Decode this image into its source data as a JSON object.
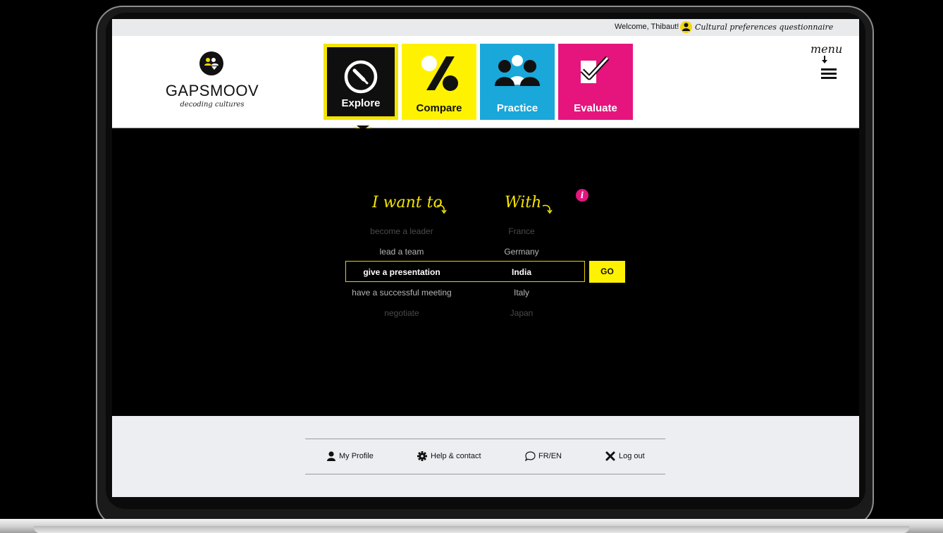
{
  "topbar": {
    "welcome": "Welcome, Thibaut!",
    "questionnaire": "Cultural preferences questionnaire"
  },
  "brand": {
    "name": "GAPSMOOV",
    "tagline": "decoding cultures"
  },
  "nav": {
    "tabs": [
      {
        "label": "Explore",
        "icon": "compass-icon",
        "color": "#0f0f0f",
        "active": true
      },
      {
        "label": "Compare",
        "icon": "percent-icon",
        "color": "#fff200",
        "active": false
      },
      {
        "label": "Practice",
        "icon": "group-icon",
        "color": "#1aa7d9",
        "active": false
      },
      {
        "label": "Evaluate",
        "icon": "checkmark-icon",
        "color": "#e5157d",
        "active": false
      }
    ],
    "menu_label": "menu"
  },
  "explore": {
    "want_heading": "I want to",
    "with_heading": "With",
    "want_options": [
      "become a leader",
      "lead a team",
      "give a presentation",
      "have a successful meeting",
      "negotiate"
    ],
    "with_options": [
      "France",
      "Germany",
      "India",
      "Italy",
      "Japan"
    ],
    "selected_want": "give a presentation",
    "selected_with": "India",
    "go_label": "GO",
    "info_icon": "i"
  },
  "footer": {
    "links": [
      {
        "label": "My Profile",
        "icon": "person-icon"
      },
      {
        "label": "Help & contact",
        "icon": "gear-icon"
      },
      {
        "label": "FR/EN",
        "icon": "chat-icon"
      },
      {
        "label": "Log out",
        "icon": "close-icon"
      }
    ]
  },
  "colors": {
    "accent_yellow": "#fff200",
    "accent_blue": "#1aa7d9",
    "accent_pink": "#e5157d",
    "background_dark": "#000000"
  }
}
